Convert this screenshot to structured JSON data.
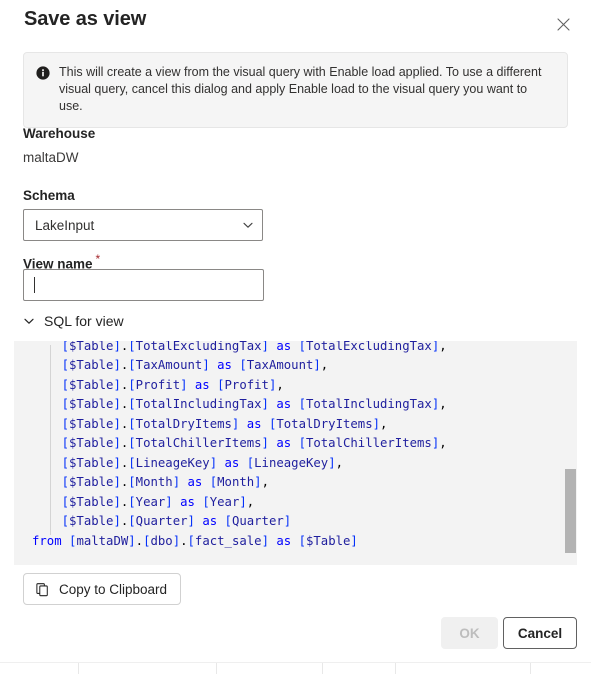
{
  "dialog": {
    "title": "Save as view",
    "close_icon": "close-icon"
  },
  "message_bar": {
    "icon": "info-icon",
    "text": "This will create a view from the visual query with Enable load applied. To use a different visual query, cancel this dialog and apply Enable load to the visual query you want to use."
  },
  "fields": {
    "warehouse": {
      "label": "Warehouse",
      "value": "maltaDW"
    },
    "schema": {
      "label": "Schema",
      "selected": "LakeInput",
      "chevron_icon": "chevron-down-icon"
    },
    "view_name": {
      "label": "View name",
      "required_marker": "*",
      "value": "",
      "placeholder": ""
    }
  },
  "sql_section": {
    "toggle_label": "SQL for view",
    "expanded": true,
    "chevron_icon": "chevron-down-icon",
    "code_lines": [
      "    [$Table].[TotalExcludingTax] as [TotalExcludingTax],",
      "    [$Table].[TaxAmount] as [TaxAmount],",
      "    [$Table].[Profit] as [Profit],",
      "    [$Table].[TotalIncludingTax] as [TotalIncludingTax],",
      "    [$Table].[TotalDryItems] as [TotalDryItems],",
      "    [$Table].[TotalChillerItems] as [TotalChillerItems],",
      "    [$Table].[LineageKey] as [LineageKey],",
      "    [$Table].[Month] as [Month],",
      "    [$Table].[Year] as [Year],",
      "    [$Table].[Quarter] as [Quarter]",
      "from [maltaDW].[dbo].[fact_sale] as [$Table]"
    ],
    "scroll_position": "bottom"
  },
  "buttons": {
    "copy": {
      "label": "Copy to Clipboard",
      "icon": "copy-icon"
    },
    "ok": {
      "label": "OK",
      "disabled": true
    },
    "cancel": {
      "label": "Cancel",
      "disabled": false
    }
  },
  "colors": {
    "accent_required": "#a4262c",
    "code_keyword": "#0000ff",
    "code_identifier": "#1f1f9e",
    "message_bar_bg": "#f5f5f5",
    "code_bg": "#f3f3f3",
    "ok_disabled_text": "#bdbdbd"
  }
}
